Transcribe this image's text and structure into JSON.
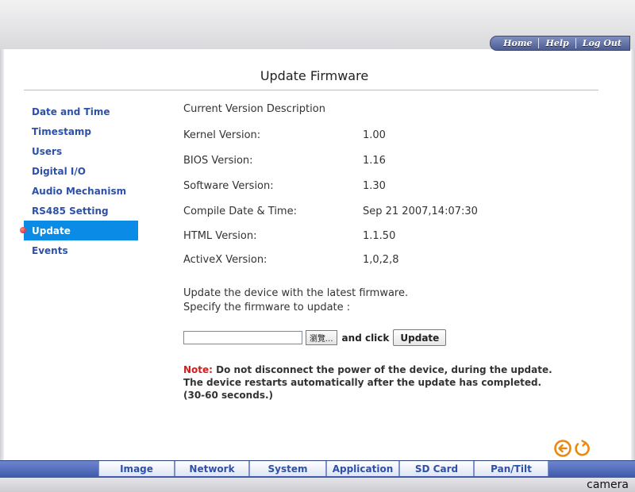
{
  "header": {
    "nav": [
      {
        "label": "Home"
      },
      {
        "label": "Help"
      },
      {
        "label": "Log Out"
      }
    ]
  },
  "page_title": "Update Firmware",
  "sidebar": {
    "items": [
      {
        "label": "Date and Time"
      },
      {
        "label": "Timestamp"
      },
      {
        "label": "Users"
      },
      {
        "label": "Digital I/O"
      },
      {
        "label": "Audio Mechanism"
      },
      {
        "label": "RS485 Setting"
      },
      {
        "label": "Update"
      },
      {
        "label": "Events"
      }
    ],
    "active_index": 6
  },
  "version_info": {
    "heading": "Current Version Description",
    "rows": [
      {
        "key": "Kernel Version:",
        "value": "1.00"
      },
      {
        "key": "BIOS Version:",
        "value": "1.16"
      },
      {
        "key": "Software Version:",
        "value": "1.30"
      },
      {
        "key": "Compile Date & Time:",
        "value": "Sep 21 2007,14:07:30"
      },
      {
        "key": "HTML Version:",
        "value": "1.1.50"
      },
      {
        "key": "ActiveX Version:",
        "value": "1,0,2,8"
      }
    ]
  },
  "update_section": {
    "line1": "Update the device with the latest firmware.",
    "line2": "Specify the firmware to update :",
    "file_value": "",
    "browse_label": "瀏覽...",
    "and_click": "and click",
    "update_button": "Update"
  },
  "note": {
    "label": "Note:",
    "text": " Do not disconnect the power of the device, during the update. The device restarts automatically after the update has completed. (30-60 seconds.)"
  },
  "bottom_tabs": [
    {
      "label": "Image"
    },
    {
      "label": "Network"
    },
    {
      "label": "System"
    },
    {
      "label": "Application"
    },
    {
      "label": "SD Card"
    },
    {
      "label": "Pan/Tilt"
    }
  ],
  "footer": {
    "brand": "camera"
  },
  "colors": {
    "accent": "#0a8ce6",
    "link": "#2d50a8",
    "note_red": "#d21c1c",
    "tabbar": "#4d66b6",
    "icon_orange": "#e88a12"
  },
  "icons": [
    "back-arrow-icon",
    "refresh-icon",
    "status-dot-icon"
  ]
}
